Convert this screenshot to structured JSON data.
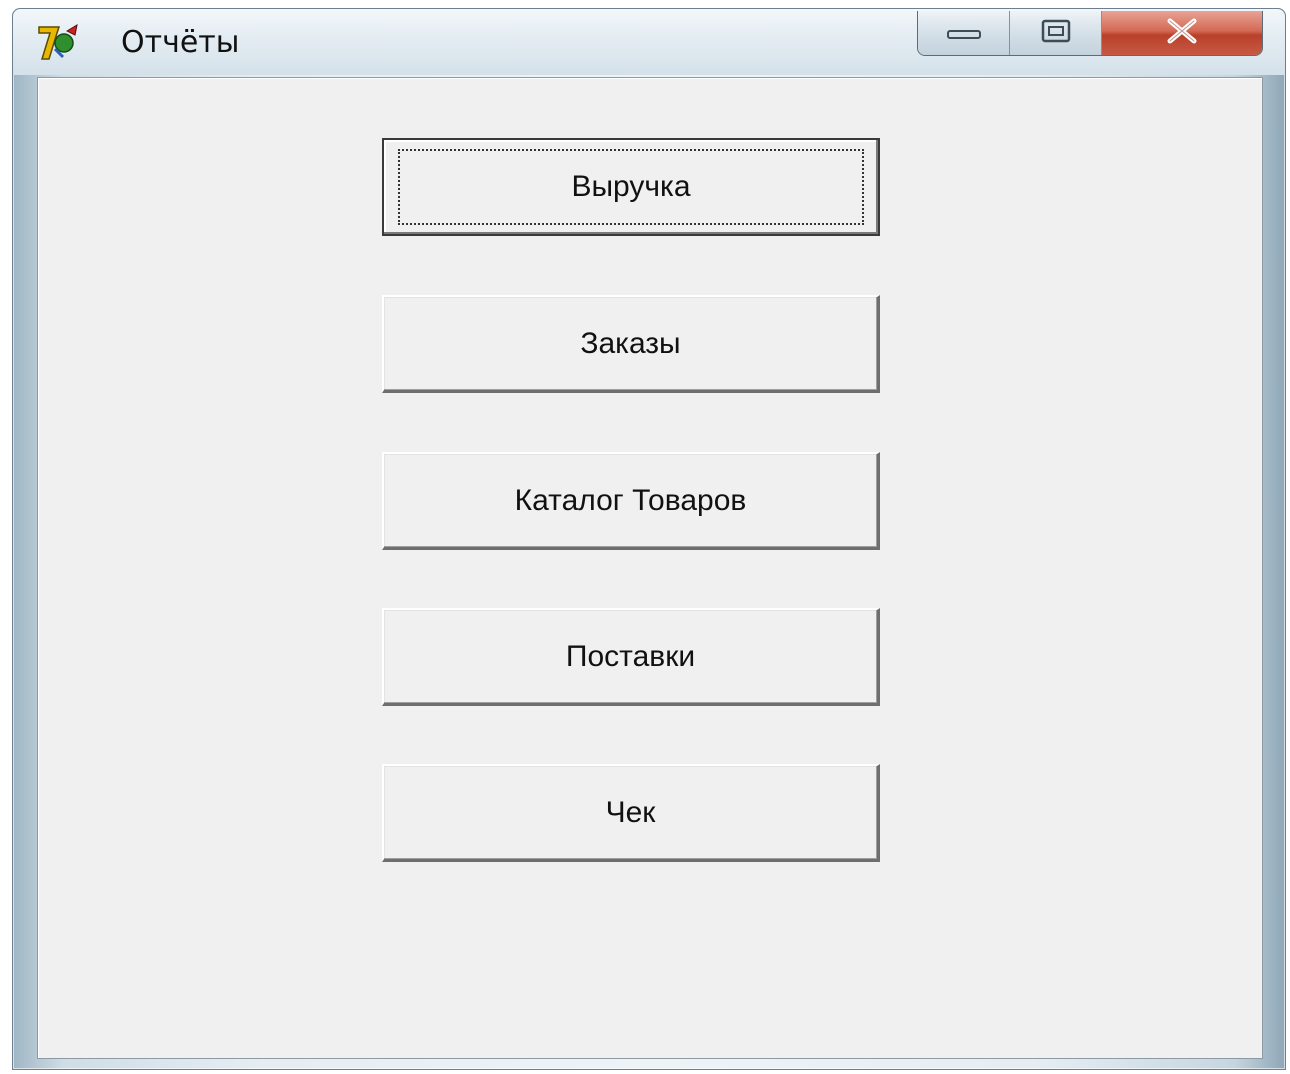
{
  "window": {
    "title": "Отчёты"
  },
  "buttons": [
    {
      "label": "Выручка"
    },
    {
      "label": "Заказы"
    },
    {
      "label": "Каталог Товаров"
    },
    {
      "label": "Поставки"
    },
    {
      "label": "Чек"
    }
  ],
  "icons": {
    "app": "app-icon",
    "minimize": "minimize-icon",
    "maximize": "maximize-icon",
    "close": "close-icon"
  },
  "colors": {
    "client_background": "#f0f0f0",
    "close_button": "#c64a34"
  }
}
